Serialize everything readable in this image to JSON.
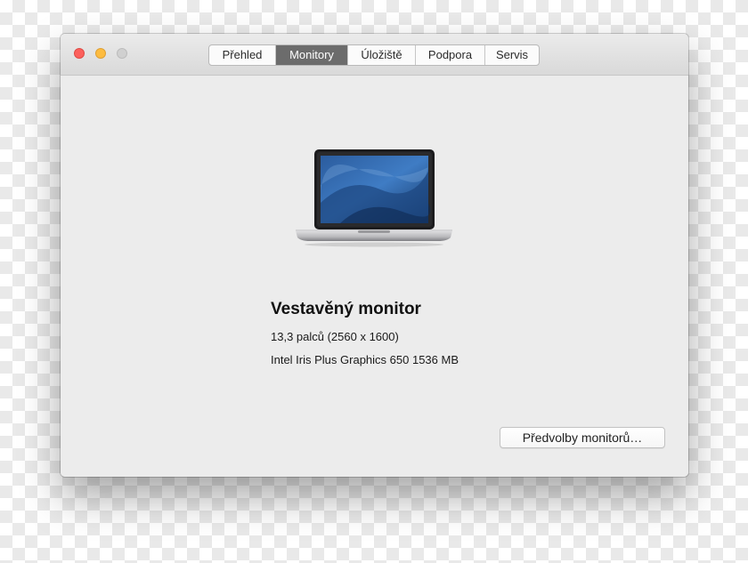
{
  "window": {
    "tabs": [
      {
        "label": "Přehled"
      },
      {
        "label": "Monitory"
      },
      {
        "label": "Úložiště"
      },
      {
        "label": "Podpora"
      },
      {
        "label": "Servis"
      }
    ],
    "active_tab": "Monitory"
  },
  "display": {
    "name": "Vestavěný monitor",
    "size": "13,3 palců (2560 x 1600)",
    "graphics": "Intel Iris Plus Graphics 650 1536 MB"
  },
  "buttons": {
    "preferences_label": "Předvolby monitorů…"
  },
  "icons": {
    "close": "close-button-icon",
    "minimize": "minimize-button-icon",
    "zoom": "zoom-button-icon",
    "laptop": "macbook-pro-icon"
  },
  "colors": {
    "close": "#fc605c",
    "minimize": "#fdbc40",
    "zoom_disabled": "#d0d0d0",
    "active_tab": "#6c6c6c"
  }
}
